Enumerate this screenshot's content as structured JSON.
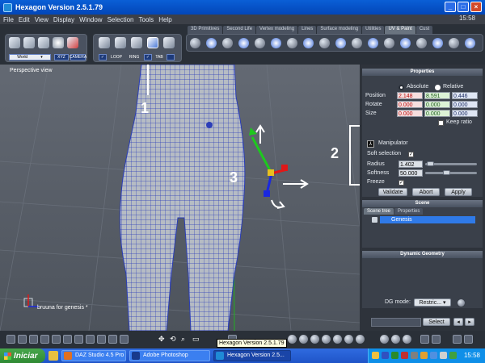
{
  "window": {
    "title": "Hexagon Version 2.5.1.79",
    "clock": "15:58"
  },
  "menu": [
    "File",
    "Edit",
    "View",
    "Display",
    "Window",
    "Selection",
    "Tools",
    "Help"
  ],
  "tabs": [
    "3D Primitives",
    "Second Life",
    "Vertex modeling",
    "Lines",
    "Surface modeling",
    "Utilities",
    "UV & Paint",
    "Cust"
  ],
  "active_tab": "UV & Paint",
  "toolbar": {
    "coord_select": "World",
    "xyz_btn": "XYZ",
    "camera_btn": "CAMERA",
    "loop_btn": "LOOP",
    "ring_btn": "RING",
    "tab_btn": "TAB"
  },
  "viewport": {
    "label": "Perspective view",
    "object_label": "bruuna for genesis *"
  },
  "annotations": {
    "one": "1",
    "two": "2",
    "three": "3"
  },
  "properties": {
    "header": "Properties",
    "absolute": "Absolute",
    "relative": "Relative",
    "rows": [
      {
        "label": "Position",
        "x": "2.148",
        "y": "8.591",
        "z": "0.446"
      },
      {
        "label": "Rotate",
        "x": "0.000",
        "y": "0.000",
        "z": "0.000"
      },
      {
        "label": "Size",
        "x": "0.000",
        "y": "0.000",
        "z": "0.000"
      }
    ],
    "keep_ratio": "Keep ratio",
    "manipulator": "Manipulator",
    "soft_selection": "Soft selection",
    "radius_label": "Radius",
    "radius_value": "1.402",
    "softness_label": "Softness",
    "softness_value": "50.000",
    "freeze": "Freeze",
    "buttons": {
      "validate": "Validate",
      "abort": "Abort",
      "apply": "Apply"
    }
  },
  "scene": {
    "header": "Scene",
    "tab_tree": "Scene tree",
    "tab_props": "Properties",
    "item": "Genesis"
  },
  "dynamic_geometry": {
    "header": "Dynamic Geometry",
    "dg_mode_label": "DG mode:",
    "dg_mode_value": "Restric..."
  },
  "bottom": {
    "select_btn": "Select"
  },
  "tooltip": "Hexagon Version 2.5.1.79",
  "taskbar": {
    "start": "Iniciar",
    "items": [
      "DAZ Studio 4.5 Pro",
      "Adobe Photoshop",
      "Hexagon Version 2.5..."
    ],
    "clock": "15:58"
  },
  "colors": {
    "accent": "#0a5fd6",
    "mesh": "#2b3eb8",
    "gizmo_x": "#e01818",
    "gizmo_y": "#1ec81e",
    "gizmo_z": "#1a28e0"
  }
}
